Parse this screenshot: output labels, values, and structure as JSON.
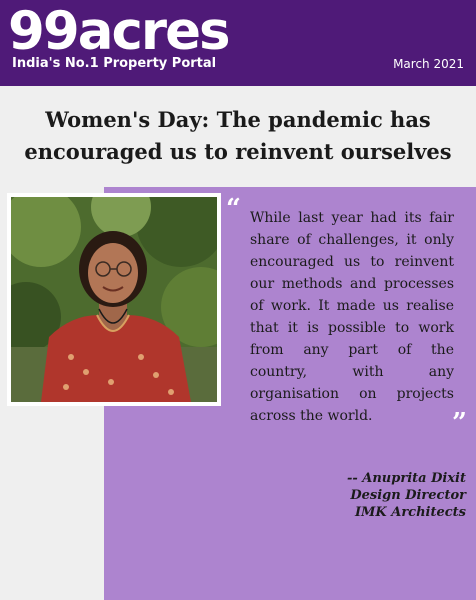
{
  "header": {
    "brand": "99acres",
    "tagline": "India's No.1 Property Portal",
    "date": "March 2021"
  },
  "headline": "Women's Day: The pandemic has encouraged us to reinvent ourselves",
  "quote": {
    "text": "While last year had its fair share of challenges, it only encouraged us to reinvent our methods and processes of work. It made us realise that it is possible to work from any part of the country, with any organisation on projects across the world."
  },
  "attribution": {
    "name": "-- Anuprita Dixit",
    "role": "Design Director",
    "company": "IMK Architects"
  },
  "colors": {
    "header_bg": "#4f1a78",
    "accent_box": "#ad84cf",
    "page_bg": "#efefef"
  }
}
